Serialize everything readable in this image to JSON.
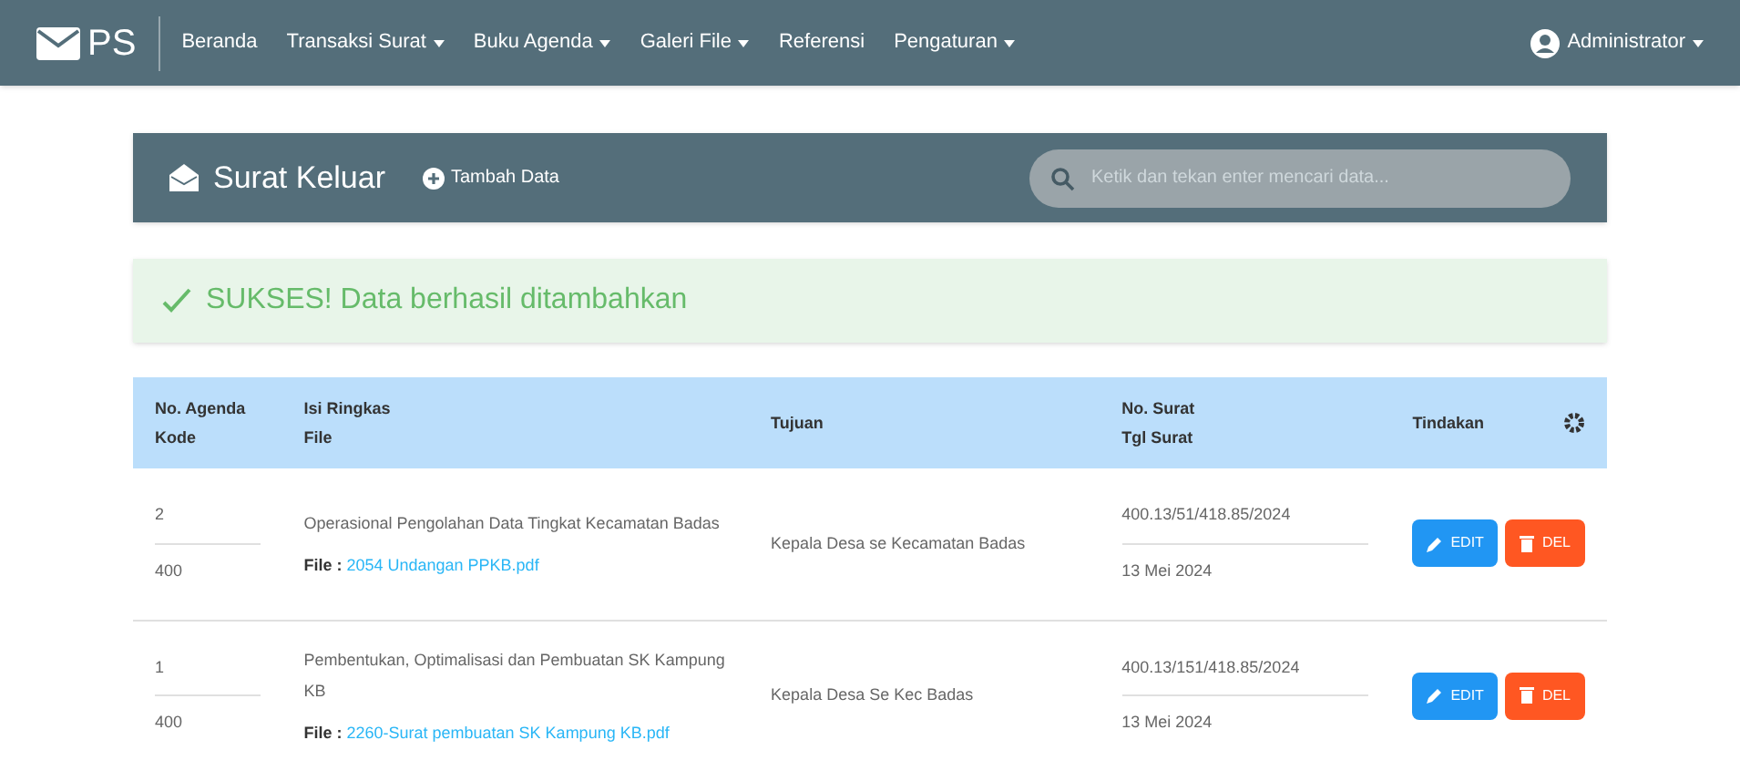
{
  "navbar": {
    "brand": "PS",
    "items": [
      {
        "label": "Beranda",
        "dropdown": false
      },
      {
        "label": "Transaksi Surat",
        "dropdown": true
      },
      {
        "label": "Buku Agenda",
        "dropdown": true
      },
      {
        "label": "Galeri File",
        "dropdown": true
      },
      {
        "label": "Referensi",
        "dropdown": false
      },
      {
        "label": "Pengaturan",
        "dropdown": true
      }
    ],
    "user": "Administrator"
  },
  "header": {
    "title": "Surat Keluar",
    "add_button": "Tambah Data",
    "search": {
      "placeholder": "Ketik dan tekan enter mencari data..."
    }
  },
  "alert": {
    "text": "SUKSES! Data berhasil ditambahkan"
  },
  "table": {
    "columns": [
      [
        "No. Agenda",
        "Kode"
      ],
      [
        "Isi Ringkas",
        "File"
      ],
      [
        "Tujuan"
      ],
      [
        "No. Surat",
        "Tgl Surat"
      ],
      [
        "Tindakan"
      ]
    ],
    "rows": [
      {
        "no_agenda": "2",
        "kode": "400",
        "isi": "Operasional Pengolahan Data Tingkat Kecamatan Badas",
        "file_label": "File :",
        "file": "2054 Undangan PPKB.pdf",
        "tujuan": "Kepala Desa se Kecamatan Badas",
        "no_surat": "400.13/51/418.85/2024",
        "tgl": "13 Mei 2024",
        "edit": "EDIT",
        "del": "DEL"
      },
      {
        "no_agenda": "1",
        "kode": "400",
        "isi": "Pembentukan, Optimalisasi dan Pembuatan SK Kampung KB",
        "file_label": "File :",
        "file": "2260-Surat pembuatan SK Kampung KB.pdf",
        "tujuan": "Kepala Desa Se Kec Badas",
        "no_surat": "400.13/151/418.85/2024",
        "tgl": "13 Mei 2024",
        "edit": "EDIT",
        "del": "DEL"
      }
    ]
  }
}
